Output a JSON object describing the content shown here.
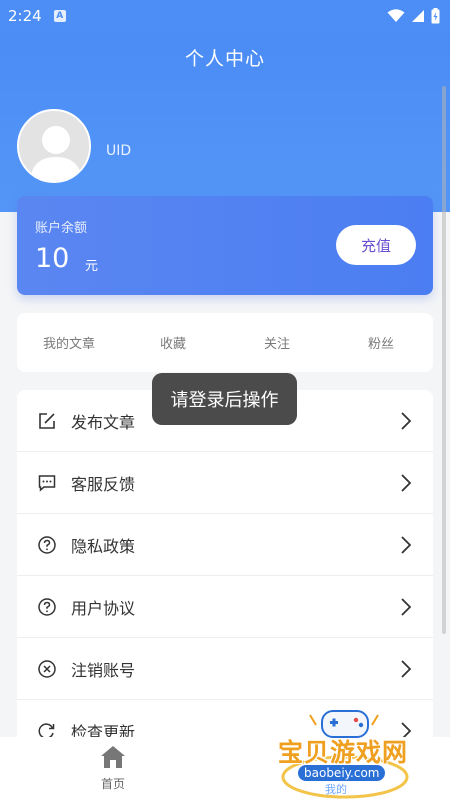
{
  "status_bar": {
    "time": "2:24",
    "a_icon": "A"
  },
  "header": {
    "title": "个人中心",
    "uid_label": "UID"
  },
  "balance": {
    "label": "账户余额",
    "value": "10",
    "unit": "元",
    "recharge_label": "充值"
  },
  "stats": [
    {
      "label": "我的文章"
    },
    {
      "label": "收藏"
    },
    {
      "label": "关注"
    },
    {
      "label": "粉丝"
    }
  ],
  "menu": [
    {
      "label": "发布文章",
      "icon": "edit-icon"
    },
    {
      "label": "客服反馈",
      "icon": "chat-icon"
    },
    {
      "label": "隐私政策",
      "icon": "question-icon"
    },
    {
      "label": "用户协议",
      "icon": "question-icon"
    },
    {
      "label": "注销账号",
      "icon": "close-circle-icon"
    },
    {
      "label": "检查更新",
      "icon": "refresh-icon"
    }
  ],
  "toast": {
    "text": "请登录后操作"
  },
  "bottom_nav": {
    "home_label": "首页",
    "mine_label": "我的"
  },
  "watermark": {
    "title": "宝贝游戏网",
    "url": "baobeiy.com"
  },
  "colors": {
    "primary": "#4c8ef5",
    "recharge_text": "#6a4fd0",
    "watermark": "#f0a020"
  }
}
